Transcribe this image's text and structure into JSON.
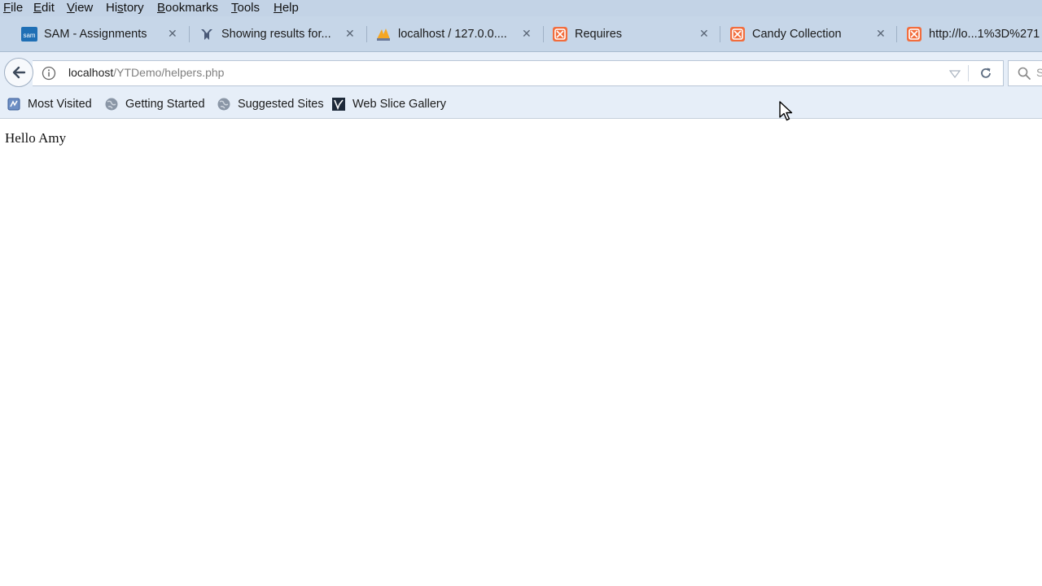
{
  "menu": [
    {
      "mnemonic": "F",
      "rest": "ile"
    },
    {
      "mnemonic": "E",
      "rest": "dit"
    },
    {
      "mnemonic": "V",
      "rest": "iew"
    },
    {
      "mnemonic": "",
      "rest": "Hi",
      "mnemonic2": "s",
      "rest2": "tory"
    },
    {
      "mnemonic": "B",
      "rest": "ookmarks"
    },
    {
      "mnemonic": "T",
      "rest": "ools"
    },
    {
      "mnemonic": "H",
      "rest": "elp"
    }
  ],
  "tabs": [
    {
      "title": "SAM - Assignments",
      "icon": "sam-favicon"
    },
    {
      "title": "Showing results for...",
      "icon": "unicorn-favicon"
    },
    {
      "title": "localhost / 127.0.0....",
      "icon": "phpmyadmin-favicon"
    },
    {
      "title": "Requires",
      "icon": "xampp-favicon"
    },
    {
      "title": "Candy Collection",
      "icon": "xampp-favicon"
    },
    {
      "title": "http://lo...1%3D%271",
      "icon": "xampp-favicon"
    }
  ],
  "sam_favicon_text": "sam",
  "url": {
    "host": "localhost",
    "path": "/YTDemo/helpers.php"
  },
  "search": {
    "placeholder": "S"
  },
  "bookmarks": [
    {
      "label": "Most Visited",
      "icon": "most-visited-icon"
    },
    {
      "label": "Getting Started",
      "icon": "globe-icon"
    },
    {
      "label": "Suggested Sites",
      "icon": "globe-icon"
    },
    {
      "label": "Web Slice Gallery",
      "icon": "web-slice-icon"
    }
  ],
  "page": {
    "text": "Hello Amy"
  },
  "colors": {
    "chrome": "#c6d6e8",
    "toolbar": "#e6eef8",
    "xampp": "#f26d3d",
    "sam_blue": "#1f6fb5"
  }
}
